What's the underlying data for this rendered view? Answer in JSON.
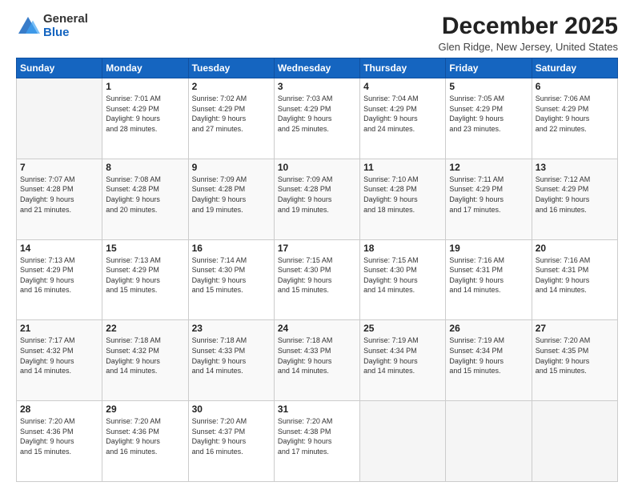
{
  "header": {
    "logo_general": "General",
    "logo_blue": "Blue",
    "month_title": "December 2025",
    "location": "Glen Ridge, New Jersey, United States"
  },
  "weekdays": [
    "Sunday",
    "Monday",
    "Tuesday",
    "Wednesday",
    "Thursday",
    "Friday",
    "Saturday"
  ],
  "weeks": [
    [
      {
        "day": "",
        "info": ""
      },
      {
        "day": "1",
        "info": "Sunrise: 7:01 AM\nSunset: 4:29 PM\nDaylight: 9 hours\nand 28 minutes."
      },
      {
        "day": "2",
        "info": "Sunrise: 7:02 AM\nSunset: 4:29 PM\nDaylight: 9 hours\nand 27 minutes."
      },
      {
        "day": "3",
        "info": "Sunrise: 7:03 AM\nSunset: 4:29 PM\nDaylight: 9 hours\nand 25 minutes."
      },
      {
        "day": "4",
        "info": "Sunrise: 7:04 AM\nSunset: 4:29 PM\nDaylight: 9 hours\nand 24 minutes."
      },
      {
        "day": "5",
        "info": "Sunrise: 7:05 AM\nSunset: 4:29 PM\nDaylight: 9 hours\nand 23 minutes."
      },
      {
        "day": "6",
        "info": "Sunrise: 7:06 AM\nSunset: 4:29 PM\nDaylight: 9 hours\nand 22 minutes."
      }
    ],
    [
      {
        "day": "7",
        "info": "Sunrise: 7:07 AM\nSunset: 4:28 PM\nDaylight: 9 hours\nand 21 minutes."
      },
      {
        "day": "8",
        "info": "Sunrise: 7:08 AM\nSunset: 4:28 PM\nDaylight: 9 hours\nand 20 minutes."
      },
      {
        "day": "9",
        "info": "Sunrise: 7:09 AM\nSunset: 4:28 PM\nDaylight: 9 hours\nand 19 minutes."
      },
      {
        "day": "10",
        "info": "Sunrise: 7:09 AM\nSunset: 4:28 PM\nDaylight: 9 hours\nand 19 minutes."
      },
      {
        "day": "11",
        "info": "Sunrise: 7:10 AM\nSunset: 4:28 PM\nDaylight: 9 hours\nand 18 minutes."
      },
      {
        "day": "12",
        "info": "Sunrise: 7:11 AM\nSunset: 4:29 PM\nDaylight: 9 hours\nand 17 minutes."
      },
      {
        "day": "13",
        "info": "Sunrise: 7:12 AM\nSunset: 4:29 PM\nDaylight: 9 hours\nand 16 minutes."
      }
    ],
    [
      {
        "day": "14",
        "info": "Sunrise: 7:13 AM\nSunset: 4:29 PM\nDaylight: 9 hours\nand 16 minutes."
      },
      {
        "day": "15",
        "info": "Sunrise: 7:13 AM\nSunset: 4:29 PM\nDaylight: 9 hours\nand 15 minutes."
      },
      {
        "day": "16",
        "info": "Sunrise: 7:14 AM\nSunset: 4:30 PM\nDaylight: 9 hours\nand 15 minutes."
      },
      {
        "day": "17",
        "info": "Sunrise: 7:15 AM\nSunset: 4:30 PM\nDaylight: 9 hours\nand 15 minutes."
      },
      {
        "day": "18",
        "info": "Sunrise: 7:15 AM\nSunset: 4:30 PM\nDaylight: 9 hours\nand 14 minutes."
      },
      {
        "day": "19",
        "info": "Sunrise: 7:16 AM\nSunset: 4:31 PM\nDaylight: 9 hours\nand 14 minutes."
      },
      {
        "day": "20",
        "info": "Sunrise: 7:16 AM\nSunset: 4:31 PM\nDaylight: 9 hours\nand 14 minutes."
      }
    ],
    [
      {
        "day": "21",
        "info": "Sunrise: 7:17 AM\nSunset: 4:32 PM\nDaylight: 9 hours\nand 14 minutes."
      },
      {
        "day": "22",
        "info": "Sunrise: 7:18 AM\nSunset: 4:32 PM\nDaylight: 9 hours\nand 14 minutes."
      },
      {
        "day": "23",
        "info": "Sunrise: 7:18 AM\nSunset: 4:33 PM\nDaylight: 9 hours\nand 14 minutes."
      },
      {
        "day": "24",
        "info": "Sunrise: 7:18 AM\nSunset: 4:33 PM\nDaylight: 9 hours\nand 14 minutes."
      },
      {
        "day": "25",
        "info": "Sunrise: 7:19 AM\nSunset: 4:34 PM\nDaylight: 9 hours\nand 14 minutes."
      },
      {
        "day": "26",
        "info": "Sunrise: 7:19 AM\nSunset: 4:34 PM\nDaylight: 9 hours\nand 15 minutes."
      },
      {
        "day": "27",
        "info": "Sunrise: 7:20 AM\nSunset: 4:35 PM\nDaylight: 9 hours\nand 15 minutes."
      }
    ],
    [
      {
        "day": "28",
        "info": "Sunrise: 7:20 AM\nSunset: 4:36 PM\nDaylight: 9 hours\nand 15 minutes."
      },
      {
        "day": "29",
        "info": "Sunrise: 7:20 AM\nSunset: 4:36 PM\nDaylight: 9 hours\nand 16 minutes."
      },
      {
        "day": "30",
        "info": "Sunrise: 7:20 AM\nSunset: 4:37 PM\nDaylight: 9 hours\nand 16 minutes."
      },
      {
        "day": "31",
        "info": "Sunrise: 7:20 AM\nSunset: 4:38 PM\nDaylight: 9 hours\nand 17 minutes."
      },
      {
        "day": "",
        "info": ""
      },
      {
        "day": "",
        "info": ""
      },
      {
        "day": "",
        "info": ""
      }
    ]
  ]
}
